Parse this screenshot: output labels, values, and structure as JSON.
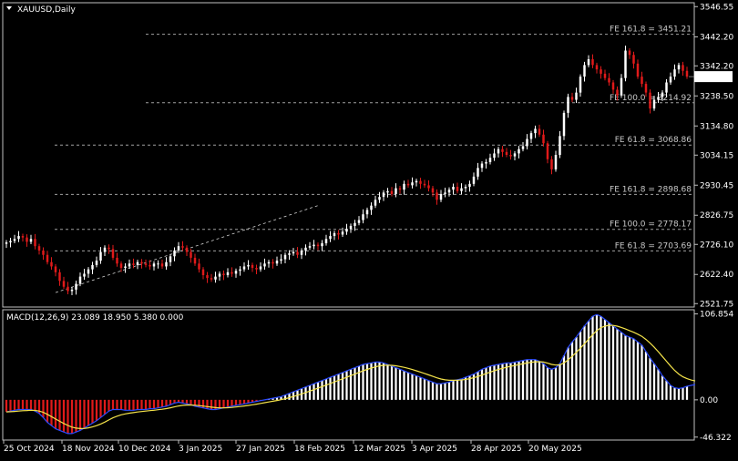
{
  "window": {
    "title": "XAUUSD,Daily",
    "collapse_icon": "triangle-down-icon"
  },
  "price_panel": {
    "current_price": "3305.03",
    "y_ticks": [
      "3546.55",
      "3442.20",
      "3342.20",
      "3238.50",
      "3134.80",
      "3034.15",
      "2930.45",
      "2826.75",
      "2726.10",
      "2622.40",
      "2521.75"
    ],
    "fib_levels": [
      {
        "label": "FE 161.8 = 3451.21",
        "value": 3451.21
      },
      {
        "label": "FE 100.0 = 3214.92",
        "value": 3214.92
      },
      {
        "label": "FE 61.8 = 3068.86",
        "value": 3068.86
      },
      {
        "label": "FE 161.8 = 2898.68",
        "value": 2898.68
      },
      {
        "label": "FE 100.0 = 2778.17",
        "value": 2778.17
      },
      {
        "label": "FE 61.8 = 2703.69",
        "value": 2703.69
      }
    ]
  },
  "macd_panel": {
    "header": "MACD(12,26,9) 23.089 18.950 5.380 0.000",
    "y_ticks": [
      "106.854",
      "0.00",
      "-46.322"
    ]
  },
  "x_axis": {
    "labels": [
      "25 Oct 2024",
      "18 Nov 2024",
      "10 Dec 2024",
      "3 Jan 2025",
      "27 Jan 2025",
      "18 Feb 2025",
      "12 Mar 2025",
      "3 Apr 2025",
      "28 Apr 2025",
      "20 May 2025"
    ]
  },
  "chart_data": {
    "type": "candlestick",
    "title": "XAUUSD,Daily",
    "ylim": [
      2510,
      3560
    ],
    "macd_ylim": [
      -50,
      112
    ],
    "series": [
      {
        "name": "XAUUSD",
        "closes": [
          2733,
          2738,
          2745,
          2755,
          2750,
          2735,
          2745,
          2720,
          2705,
          2690,
          2665,
          2650,
          2630,
          2600,
          2580,
          2565,
          2570,
          2590,
          2615,
          2625,
          2640,
          2655,
          2670,
          2700,
          2715,
          2710,
          2680,
          2660,
          2645,
          2650,
          2660,
          2655,
          2665,
          2660,
          2655,
          2650,
          2660,
          2660,
          2650,
          2665,
          2685,
          2705,
          2720,
          2715,
          2700,
          2680,
          2660,
          2640,
          2620,
          2610,
          2605,
          2615,
          2625,
          2620,
          2630,
          2625,
          2635,
          2640,
          2650,
          2655,
          2645,
          2640,
          2650,
          2660,
          2665,
          2660,
          2670,
          2675,
          2690,
          2695,
          2700,
          2690,
          2705,
          2715,
          2720,
          2725,
          2720,
          2730,
          2745,
          2755,
          2765,
          2760,
          2770,
          2780,
          2790,
          2800,
          2810,
          2830,
          2845,
          2860,
          2880,
          2890,
          2905,
          2910,
          2900,
          2920,
          2915,
          2935,
          2930,
          2940,
          2945,
          2935,
          2930,
          2920,
          2905,
          2880,
          2900,
          2905,
          2915,
          2925,
          2910,
          2920,
          2925,
          2935,
          2960,
          2990,
          3005,
          3010,
          3025,
          3040,
          3055,
          3045,
          3035,
          3030,
          3040,
          3055,
          3065,
          3090,
          3110,
          3125,
          3105,
          3075,
          3020,
          2985,
          3035,
          3100,
          3180,
          3235,
          3225,
          3250,
          3305,
          3345,
          3365,
          3345,
          3330,
          3315,
          3300,
          3285,
          3260,
          3240,
          3300,
          3395,
          3380,
          3350,
          3305,
          3280,
          3250,
          3195,
          3225,
          3235,
          3250,
          3285,
          3305,
          3330,
          3345,
          3325,
          3305
        ]
      }
    ],
    "macd": [
      -15,
      -14,
      -13,
      -12,
      -12,
      -12,
      -12,
      -14,
      -17,
      -22,
      -28,
      -32,
      -36,
      -38,
      -40,
      -42,
      -42,
      -40,
      -38,
      -35,
      -32,
      -29,
      -26,
      -22,
      -18,
      -14,
      -12,
      -12,
      -12,
      -13,
      -13,
      -13,
      -12,
      -12,
      -12,
      -11,
      -11,
      -10,
      -9,
      -8,
      -6,
      -4,
      -3,
      -4,
      -5,
      -6,
      -8,
      -9,
      -10,
      -11,
      -12,
      -12,
      -11,
      -10,
      -9,
      -8,
      -7,
      -6,
      -5,
      -4,
      -3,
      -2,
      -1,
      0,
      1,
      2,
      3,
      4,
      6,
      8,
      10,
      12,
      14,
      16,
      18,
      20,
      22,
      24,
      26,
      28,
      30,
      32,
      34,
      36,
      38,
      40,
      42,
      44,
      45,
      46,
      47,
      47,
      46,
      44,
      42,
      40,
      38,
      36,
      34,
      32,
      30,
      28,
      26,
      24,
      22,
      20,
      20,
      21,
      22,
      24,
      25,
      26,
      28,
      30,
      32,
      35,
      38,
      40,
      42,
      43,
      44,
      45,
      46,
      46,
      47,
      48,
      49,
      50,
      50,
      50,
      48,
      45,
      40,
      38,
      40,
      45,
      55,
      65,
      72,
      78,
      85,
      92,
      98,
      104,
      106,
      104,
      100,
      96,
      92,
      88,
      84,
      80,
      78,
      76,
      72,
      68,
      60,
      52,
      45,
      38,
      30,
      24,
      18,
      15,
      14,
      15,
      17,
      18,
      19
    ]
  }
}
